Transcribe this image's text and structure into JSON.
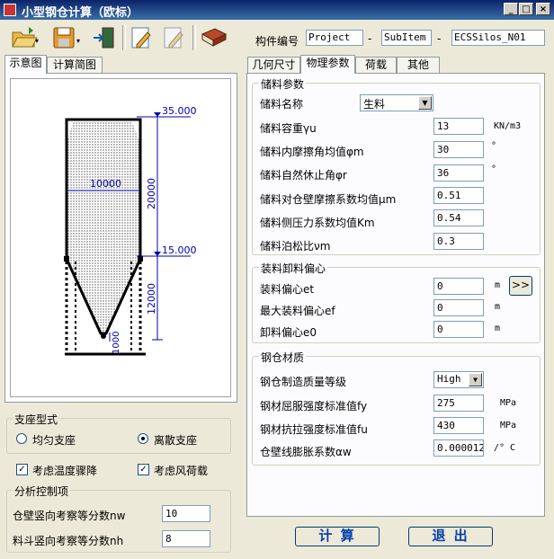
{
  "window": {
    "title": "小型钢仓计算（欧标）",
    "controls": {
      "minimize": "_",
      "maximize": "□",
      "close": "×"
    }
  },
  "toolbar": {
    "icons": [
      "open-folder-icon",
      "save-icon",
      "exit-door-icon",
      "edit-icon",
      "edit-disabled-icon",
      "book-icon"
    ],
    "code_label": "构件编号",
    "code_project": "Project",
    "code_subitem": "SubItem",
    "code_number": "ECSSilos_N01",
    "dash": "-"
  },
  "left_tabs": [
    "示意图",
    "计算简图"
  ],
  "diagram": {
    "top_elev": "35.000",
    "mid_elev": "15.000",
    "diameter": "10000",
    "cyl_height": "20000",
    "cone_height": "12000",
    "outlet": "1000"
  },
  "support": {
    "title": "支座型式",
    "option1": "均匀支座",
    "option2": "离散支座",
    "selected": "option2"
  },
  "checks": {
    "temp_label": "考虑温度骤降",
    "wind_label": "考虑风荷载",
    "check_mark": "✓"
  },
  "analysis": {
    "title": "分析控制项",
    "nw_label": "仓壁竖向考察等分数nw",
    "nw_value": "10",
    "nh_label": "料斗竖向考察等分数nh",
    "nh_value": "8"
  },
  "right_tabs": [
    "几何尺寸",
    "物理参数",
    "荷载",
    "其他"
  ],
  "material": {
    "title": "储料参数",
    "name_label": "储料名称",
    "name_value": "生料",
    "rows": [
      {
        "label": "储料容重γu",
        "value": "13",
        "unit": "KN/m3"
      },
      {
        "label": "储料内摩擦角均值φm",
        "value": "30",
        "unit": "°"
      },
      {
        "label": "储料自然休止角φr",
        "value": "36",
        "unit": "°"
      },
      {
        "label": "储料对仓壁摩擦系数均值μm",
        "value": "0.51",
        "unit": ""
      },
      {
        "label": "储料侧压力系数均值Km",
        "value": "0.54",
        "unit": ""
      },
      {
        "label": "储料泊松比νm",
        "value": "0.3",
        "unit": ""
      }
    ]
  },
  "eccentric": {
    "title": "装料卸料偏心",
    "rows": [
      {
        "label": "装料偏心et",
        "value": "0",
        "unit": "m"
      },
      {
        "label": "最大装料偏心ef",
        "value": "0",
        "unit": "m"
      },
      {
        "label": "卸料偏心e0",
        "value": "0",
        "unit": "m"
      }
    ],
    "more_button": ">>"
  },
  "steel": {
    "title": "钢仓材质",
    "grade_label": "钢仓制造质量等级",
    "grade_value": "High",
    "rows": [
      {
        "label": "钢材屈服强度标准值fy",
        "value": "275",
        "unit": "MPa"
      },
      {
        "label": "钢材抗拉强度标准值fu",
        "value": "430",
        "unit": "MPa"
      },
      {
        "label": "仓壁线膨胀系数αw",
        "value": "0.000012",
        "unit": "/° C"
      }
    ]
  },
  "buttons": {
    "calc": "计 算",
    "exit": "退 出"
  }
}
